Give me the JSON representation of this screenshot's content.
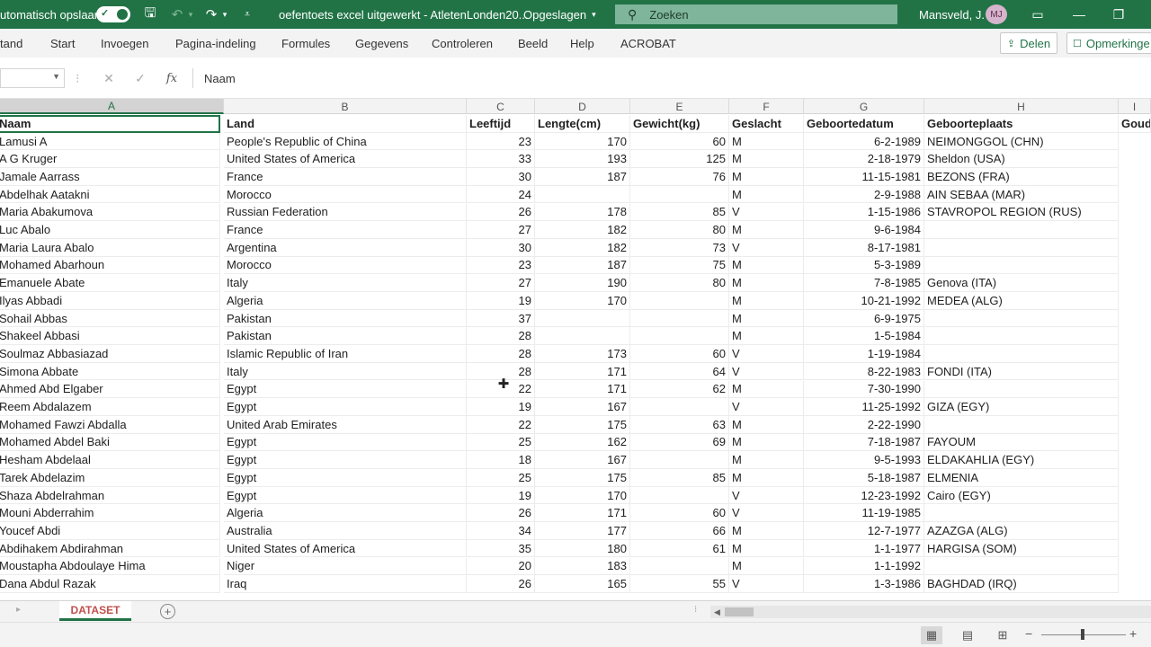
{
  "titlebar": {
    "autosave_label": "utomatisch opslaan",
    "document_title": "oefentoets excel uitgewerkt - AtletenLonden20...",
    "save_status": "Opgeslagen",
    "search_placeholder": "Zoeken",
    "user_name": "Mansveld, J.",
    "user_initials": "MJ"
  },
  "ribbon": {
    "tabs": [
      "tand",
      "Start",
      "Invoegen",
      "Pagina-indeling",
      "Formules",
      "Gegevens",
      "Controleren",
      "Beeld",
      "Help",
      "ACROBAT"
    ],
    "share_label": "Delen",
    "comments_label": "Opmerkinge"
  },
  "formula_bar": {
    "name_box": "",
    "fx": "fx",
    "content": "Naam"
  },
  "columns": [
    "A",
    "B",
    "C",
    "D",
    "E",
    "F",
    "G",
    "H",
    "I"
  ],
  "header_row": [
    "Naam",
    "Land",
    "Leeftijd",
    "Lengte(cm)",
    "Gewicht(kg)",
    "Geslacht",
    "Geboortedatum",
    "Geboorteplaats",
    "Goud"
  ],
  "rows": [
    [
      "Lamusi A",
      "People's Republic of China",
      "23",
      "170",
      "60",
      "M",
      "6-2-1989",
      "NEIMONGGOL (CHN)"
    ],
    [
      "A G Kruger",
      "United States of America",
      "33",
      "193",
      "125",
      "M",
      "2-18-1979",
      "Sheldon (USA)"
    ],
    [
      "Jamale Aarrass",
      "France",
      "30",
      "187",
      "76",
      "M",
      "11-15-1981",
      "BEZONS (FRA)"
    ],
    [
      "Abdelhak Aatakni",
      "Morocco",
      "24",
      "",
      "",
      "M",
      "2-9-1988",
      "AIN SEBAA (MAR)"
    ],
    [
      "Maria Abakumova",
      "Russian Federation",
      "26",
      "178",
      "85",
      "V",
      "1-15-1986",
      "STAVROPOL REGION (RUS)"
    ],
    [
      "Luc Abalo",
      "France",
      "27",
      "182",
      "80",
      "M",
      "9-6-1984",
      ""
    ],
    [
      "Maria Laura Abalo",
      "Argentina",
      "30",
      "182",
      "73",
      "V",
      "8-17-1981",
      ""
    ],
    [
      "Mohamed Abarhoun",
      "Morocco",
      "23",
      "187",
      "75",
      "M",
      "5-3-1989",
      ""
    ],
    [
      "Emanuele Abate",
      "Italy",
      "27",
      "190",
      "80",
      "M",
      "7-8-1985",
      "Genova (ITA)"
    ],
    [
      "Ilyas Abbadi",
      "Algeria",
      "19",
      "170",
      "",
      "M",
      "10-21-1992",
      "MEDEA (ALG)"
    ],
    [
      "Sohail Abbas",
      "Pakistan",
      "37",
      "",
      "",
      "M",
      "6-9-1975",
      ""
    ],
    [
      "Shakeel Abbasi",
      "Pakistan",
      "28",
      "",
      "",
      "M",
      "1-5-1984",
      ""
    ],
    [
      "Soulmaz Abbasiazad",
      "Islamic Republic of Iran",
      "28",
      "173",
      "60",
      "V",
      "1-19-1984",
      ""
    ],
    [
      "Simona Abbate",
      "Italy",
      "28",
      "171",
      "64",
      "V",
      "8-22-1983",
      "FONDI (ITA)"
    ],
    [
      "Ahmed Abd Elgaber",
      "Egypt",
      "22",
      "171",
      "62",
      "M",
      "7-30-1990",
      ""
    ],
    [
      "Reem Abdalazem",
      "Egypt",
      "19",
      "167",
      "",
      "V",
      "11-25-1992",
      "GIZA (EGY)"
    ],
    [
      "Mohamed Fawzi Abdalla",
      "United Arab Emirates",
      "22",
      "175",
      "63",
      "M",
      "2-22-1990",
      ""
    ],
    [
      "Mohamed Abdel Baki",
      "Egypt",
      "25",
      "162",
      "69",
      "M",
      "7-18-1987",
      "FAYOUM"
    ],
    [
      "Hesham Abdelaal",
      "Egypt",
      "18",
      "167",
      "",
      "M",
      "9-5-1993",
      "ELDAKAHLIA (EGY)"
    ],
    [
      "Tarek Abdelazim",
      "Egypt",
      "25",
      "175",
      "85",
      "M",
      "5-18-1987",
      "ELMENIA"
    ],
    [
      "Shaza Abdelrahman",
      "Egypt",
      "19",
      "170",
      "",
      "V",
      "12-23-1992",
      "Cairo (EGY)"
    ],
    [
      "Mouni Abderrahim",
      "Algeria",
      "26",
      "171",
      "60",
      "V",
      "11-19-1985",
      ""
    ],
    [
      "Youcef Abdi",
      "Australia",
      "34",
      "177",
      "66",
      "M",
      "12-7-1977",
      "AZAZGA (ALG)"
    ],
    [
      "Abdihakem Abdirahman",
      "United States of America",
      "35",
      "180",
      "61",
      "M",
      "1-1-1977",
      "HARGISA (SOM)"
    ],
    [
      "Moustapha Abdoulaye Hima",
      "Niger",
      "20",
      "183",
      "",
      "M",
      "1-1-1992",
      ""
    ],
    [
      "Dana Abdul Razak",
      "Iraq",
      "26",
      "165",
      "55",
      "V",
      "1-3-1986",
      "BAGHDAD (IRQ)"
    ]
  ],
  "sheet_tab": "DATASET",
  "colors": {
    "accent": "#217346",
    "sheet_tab_text": "#c0504d"
  }
}
